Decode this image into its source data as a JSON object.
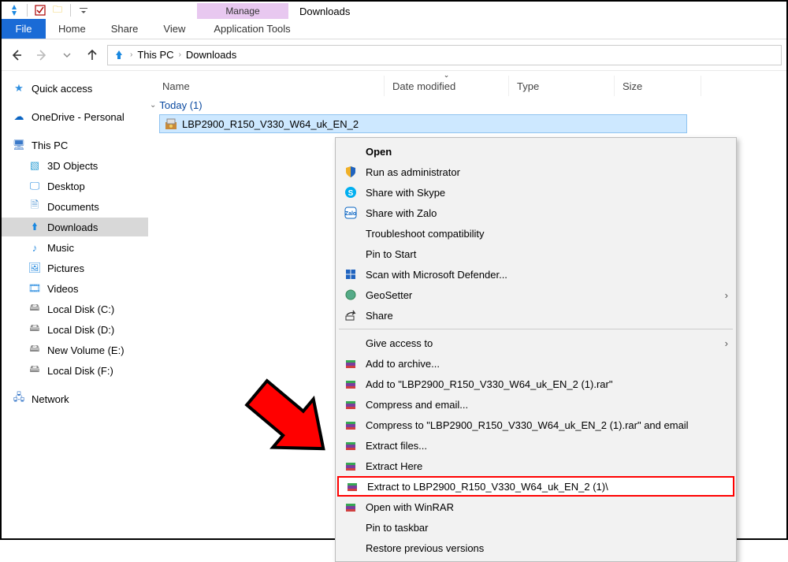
{
  "window": {
    "title": "Downloads",
    "context_tab": "Manage",
    "context_subtab": "Application Tools"
  },
  "ribbon": {
    "file": "File",
    "tabs": [
      "Home",
      "Share",
      "View",
      "Application Tools"
    ]
  },
  "address": {
    "root": "This PC",
    "folder": "Downloads"
  },
  "columns": {
    "name": "Name",
    "date": "Date modified",
    "type": "Type",
    "size": "Size"
  },
  "group": {
    "label": "Today (1)"
  },
  "file_item": {
    "name": "LBP2900_R150_V330_W64_uk_EN_2"
  },
  "sidebar": {
    "quick_access": "Quick access",
    "onedrive": "OneDrive - Personal",
    "this_pc": "This PC",
    "children": [
      "3D Objects",
      "Desktop",
      "Documents",
      "Downloads",
      "Music",
      "Pictures",
      "Videos",
      "Local Disk (C:)",
      "Local Disk (D:)",
      "New Volume (E:)",
      "Local Disk (F:)"
    ],
    "network": "Network"
  },
  "context_menu": {
    "open": "Open",
    "run_admin": "Run as administrator",
    "skype": "Share with Skype",
    "zalo": "Share with Zalo",
    "troubleshoot": "Troubleshoot compatibility",
    "pin_start": "Pin to Start",
    "defender": "Scan with Microsoft Defender...",
    "geosetter": "GeoSetter",
    "share": "Share",
    "give_access": "Give access to",
    "add_archive": "Add to archive...",
    "add_named": "Add to \"LBP2900_R150_V330_W64_uk_EN_2 (1).rar\"",
    "compress_email": "Compress and email...",
    "compress_named_email": "Compress to \"LBP2900_R150_V330_W64_uk_EN_2 (1).rar\" and email",
    "extract_files": "Extract files...",
    "extract_here": "Extract Here",
    "extract_to": "Extract to LBP2900_R150_V330_W64_uk_EN_2 (1)\\",
    "open_winrar": "Open with WinRAR",
    "pin_taskbar": "Pin to taskbar",
    "restore": "Restore previous versions"
  }
}
